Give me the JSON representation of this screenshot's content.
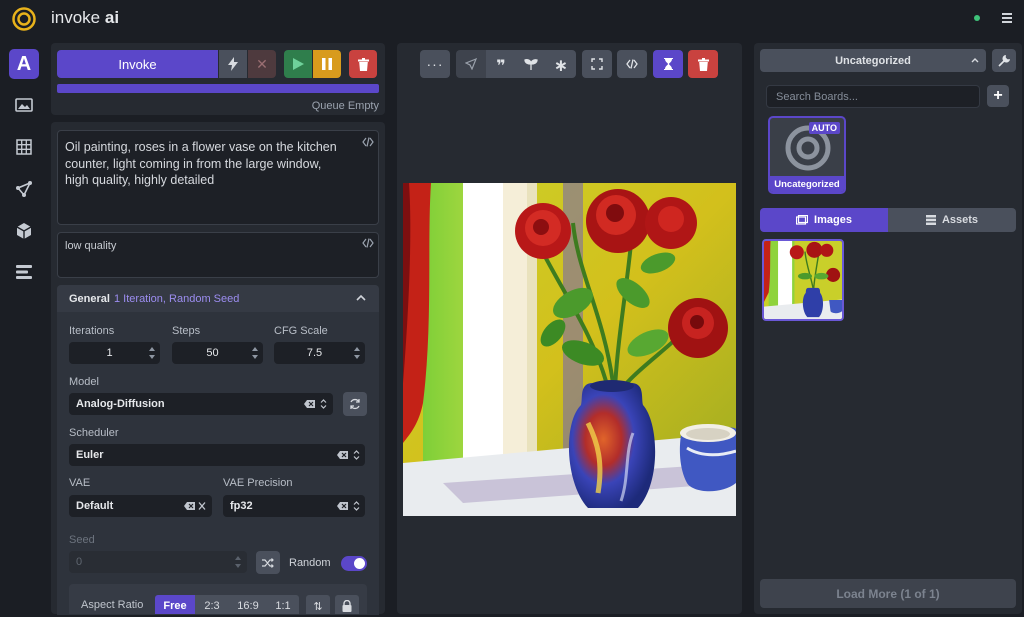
{
  "header": {
    "brand_prefix": "invoke",
    "brand_suffix": "ai"
  },
  "colors": {
    "accent": "#5b47c9",
    "success": "#3fc37a",
    "danger": "#c9423f",
    "warning": "#d89b1d"
  },
  "sidebar": {
    "items": [
      {
        "icon": "text-to-image-icon"
      },
      {
        "icon": "image-to-image-icon"
      },
      {
        "icon": "grid-icon"
      },
      {
        "icon": "nodes-icon"
      },
      {
        "icon": "model-manager-icon"
      },
      {
        "icon": "queue-list-icon"
      }
    ]
  },
  "invoke": {
    "label": "Invoke",
    "queue_status": "Queue Empty"
  },
  "prompts": {
    "positive": "Oil painting, roses in a flower vase on the kitchen counter, light coming in from the large window, high quality, highly detailed",
    "negative": "low quality"
  },
  "general": {
    "title": "General",
    "summary": "1 Iteration, Random Seed",
    "iterations": {
      "label": "Iterations",
      "value": "1"
    },
    "steps": {
      "label": "Steps",
      "value": "50"
    },
    "cfg": {
      "label": "CFG Scale",
      "value": "7.5"
    },
    "model": {
      "label": "Model",
      "value": "Analog-Diffusion"
    },
    "scheduler": {
      "label": "Scheduler",
      "value": "Euler"
    },
    "vae": {
      "label": "VAE",
      "value": "Default"
    },
    "vae_precision": {
      "label": "VAE Precision",
      "value": "fp32"
    },
    "seed": {
      "label": "Seed",
      "value": "0",
      "random_label": "Random",
      "random_on": true
    },
    "aspect": {
      "label": "Aspect Ratio",
      "options": [
        "Free",
        "2:3",
        "16:9",
        "1:1"
      ],
      "selected": "Free"
    }
  },
  "gallery": {
    "board_select": "Uncategorized",
    "search_placeholder": "Search Boards...",
    "board": {
      "name": "Uncategorized",
      "badge": "AUTO"
    },
    "tabs": {
      "images": "Images",
      "assets": "Assets"
    },
    "load_more": "Load More (1 of 1)"
  }
}
